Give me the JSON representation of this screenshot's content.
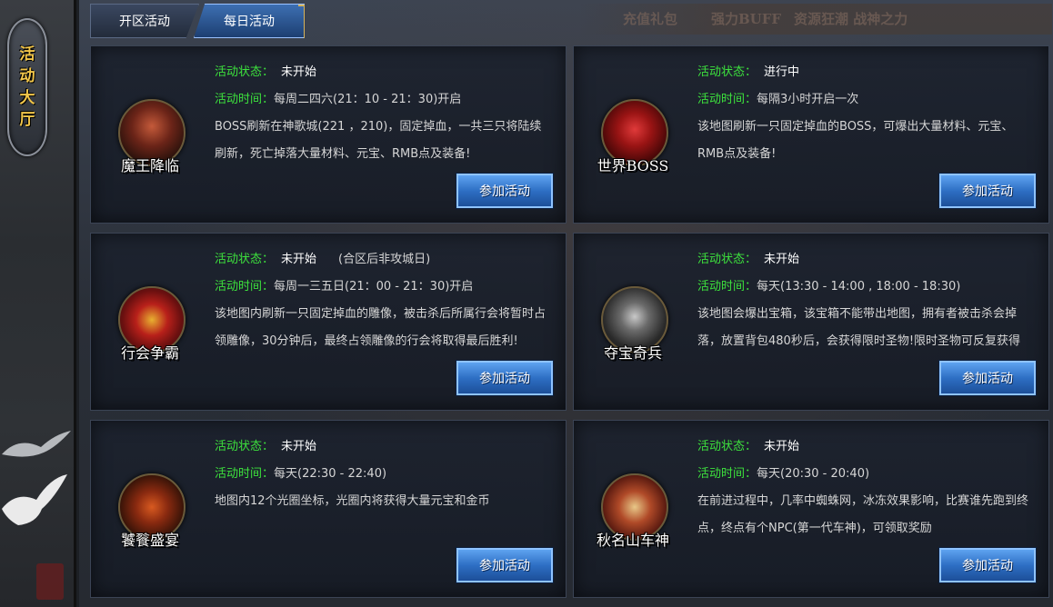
{
  "sidebar": {
    "title_chars": [
      "活",
      "动",
      "大",
      "厅"
    ]
  },
  "tabs": [
    {
      "label": "开区活动",
      "active": false
    },
    {
      "label": "每日活动",
      "active": true
    }
  ],
  "activities": [
    {
      "name": "魔王降临",
      "status_label": "活动状态：",
      "status": "未开始",
      "status_note": "",
      "time_label": "活动时间：",
      "time": "每周二四六(21：10 - 21：30)开启",
      "description": "BOSS刷新在神歌城(221 ，210)，固定掉血，一共三只将陆续刷新，死亡掉落大量材料、元宝、RMB点及装备!",
      "button": "参加活动"
    },
    {
      "name": "世界BOSS",
      "status_label": "活动状态：",
      "status": "进行中",
      "status_note": "",
      "time_label": "活动时间：",
      "time": "每隔3小时开启一次",
      "description": "该地图刷新一只固定掉血的BOSS，可爆出大量材料、元宝、RMB点及装备!",
      "button": "参加活动"
    },
    {
      "name": "行会争霸",
      "status_label": "活动状态：",
      "status": "未开始",
      "status_note": "(合区后非攻城日)",
      "time_label": "活动时间：",
      "time": "每周一三五日(21：00 - 21：30)开启",
      "description": "该地图内刷新一只固定掉血的雕像，被击杀后所属行会将暂时占领雕像，30分钟后，最终占领雕像的行会将取得最后胜利!",
      "button": "参加活动"
    },
    {
      "name": "夺宝奇兵",
      "status_label": "活动状态：",
      "status": "未开始",
      "status_note": "",
      "time_label": "活动时间：",
      "time": "每天(13:30 - 14:00 , 18:00 - 18:30)",
      "description": "该地图会爆出宝箱，该宝箱不能带出地图，拥有者被击杀会掉落，放置背包480秒后，会获得限时圣物!限时圣物可反复获得",
      "button": "参加活动"
    },
    {
      "name": "饕餮盛宴",
      "status_label": "活动状态：",
      "status": "未开始",
      "status_note": "",
      "time_label": "活动时间：",
      "time": "每天(22:30 - 22:40)",
      "description": "地图内12个光圈坐标，光圈内将获得大量元宝和金币",
      "button": "参加活动"
    },
    {
      "name": "秋名山车神",
      "status_label": "活动状态：",
      "status": "未开始",
      "status_note": "",
      "time_label": "活动时间：",
      "time": "每天(20:30 - 20:40)",
      "description": "在前进过程中，几率中蜘蛛网，冰冻效果影响，比赛谁先跑到终点，终点有个NPC(第一代车神)，可领取奖励",
      "button": "参加活动"
    }
  ],
  "banner_text": [
    "充值礼包",
    "强力BUFF",
    "资源狂潮 战神之力"
  ],
  "colors": {
    "label_green": "#3de23d",
    "button_blue": "#2e6fc4",
    "status_white": "#ffffff"
  }
}
